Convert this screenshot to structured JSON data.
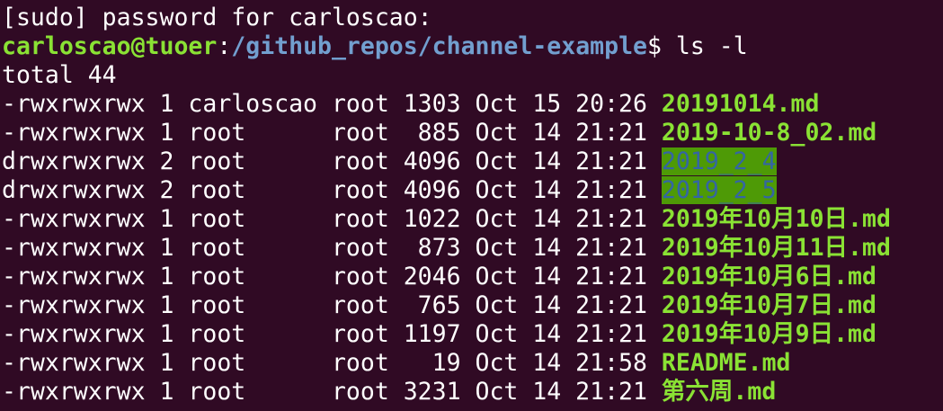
{
  "terminal": {
    "colors": {
      "background": "#300a24",
      "foreground": "#ffffff",
      "user_host": "#8ae234",
      "path": "#729fcf",
      "executable": "#8ae234",
      "dir_fg": "#3465a4",
      "dir_bg": "#4e9a06"
    },
    "sudo_prompt": "[sudo] password for carloscao:",
    "prompt": {
      "user_host": "carloscao@tuoer",
      "separator": ":",
      "path": "/github_repos/channel-example",
      "symbol": "$",
      "command": " ls -l"
    },
    "total": "total 44",
    "entries": [
      {
        "meta": "-rwxrwxrwx 1 carloscao root 1303 Oct 15 20:26 ",
        "name": "20191014.md",
        "type": "exec"
      },
      {
        "meta": "-rwxrwxrwx 1 root      root  885 Oct 14 21:21 ",
        "name": "2019-10-8_02.md",
        "type": "exec"
      },
      {
        "meta": "drwxrwxrwx 2 root      root 4096 Oct 14 21:21 ",
        "name": "2019_2_4",
        "type": "dir"
      },
      {
        "meta": "drwxrwxrwx 2 root      root 4096 Oct 14 21:21 ",
        "name": "2019_2_5",
        "type": "dir"
      },
      {
        "meta": "-rwxrwxrwx 1 root      root 1022 Oct 14 21:21 ",
        "name": "2019年10月10日.md",
        "type": "exec"
      },
      {
        "meta": "-rwxrwxrwx 1 root      root  873 Oct 14 21:21 ",
        "name": "2019年10月11日.md",
        "type": "exec"
      },
      {
        "meta": "-rwxrwxrwx 1 root      root 2046 Oct 14 21:21 ",
        "name": "2019年10月6日.md",
        "type": "exec"
      },
      {
        "meta": "-rwxrwxrwx 1 root      root  765 Oct 14 21:21 ",
        "name": "2019年10月7日.md",
        "type": "exec"
      },
      {
        "meta": "-rwxrwxrwx 1 root      root 1197 Oct 14 21:21 ",
        "name": "2019年10月9日.md",
        "type": "exec"
      },
      {
        "meta": "-rwxrwxrwx 1 root      root   19 Oct 14 21:58 ",
        "name": "README.md",
        "type": "exec"
      },
      {
        "meta": "-rwxrwxrwx 1 root      root 3231 Oct 14 21:21 ",
        "name": "第六周.md",
        "type": "exec"
      }
    ]
  }
}
